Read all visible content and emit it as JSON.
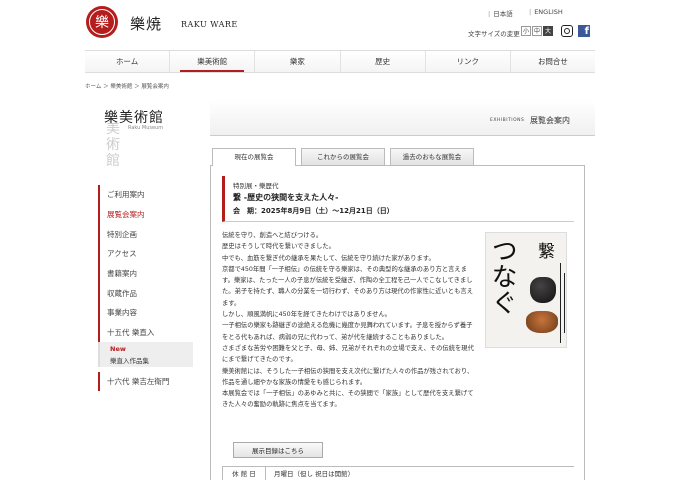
{
  "header": {
    "logo_char": "樂",
    "brand_ja": "樂焼",
    "brand_en": "RAKU WARE",
    "lang_ja": "日本語",
    "lang_en": "ENGLISH",
    "font_size_label": "文字サイズの変更",
    "font_sizes": [
      "小",
      "中",
      "大"
    ],
    "social": [
      "instagram-icon",
      "facebook-icon"
    ]
  },
  "nav": {
    "items": [
      "ホーム",
      "樂美術館",
      "樂家",
      "歴史",
      "リンク",
      "お問合せ"
    ],
    "active_index": 1
  },
  "breadcrumb": "ホーム ＞ 樂美術館 ＞ 展覧会案内",
  "museum": {
    "title": "樂美術館",
    "subtitle": "Raku Museum"
  },
  "banner": {
    "en": "EXHIBITIONS",
    "ja": "展覧会案内"
  },
  "sidebar": {
    "items": [
      "ご利用案内",
      "展覧会案内",
      "特別企画",
      "アクセス",
      "書籍案内",
      "収蔵作品",
      "事業内容",
      "十五代 樂直入"
    ],
    "active_index": 1,
    "sub_new": "New",
    "sub_label": "樂直入作品集",
    "last_item": "十六代 樂吉左衛門"
  },
  "tabs": [
    "現在の展覧会",
    "これからの展覧会",
    "過去のおもな展覧会"
  ],
  "exhibition": {
    "category": "特別展・樂歴代",
    "title": "繋 -歴史の狭間を支えた人々-",
    "period": "会　期：2025年8月9日（土）～12月21日（日）"
  },
  "body_paragraphs": [
    "伝統を守り、創造へと結びつける。",
    "歴史はそうして時代を繋いできました。",
    "中でも、血筋を繋ぎ代の継承を果たして、伝統を守り続けた家があります。",
    "京都で450年間「一子相伝」の伝統を守る樂家は、その典型的な継承のあり方と言えます。樂家は、たった一人の子息が伝統を受継ぎ、作陶の全工程を己一人でこなしてきました。弟子を持たず、職人の分業を一切行わず、そのあり方は現代の作家性に近いとも言えます。",
    "しかし、順風満帆に450年を経てきたわけではありません。",
    "一子相伝の樂家も跡継ぎの途絶える危機に幾度か見舞われています。子息を授からず養子をとる代もあれば、病弱の兄に代わって、弟が代を継続することもありました。",
    "さまざまな苦労や困難を父と子、母、姉、兄弟がそれぞれの立場で支え、その伝統を現代にまで繋げてきたのです。",
    "樂美術館には、そうした一子相伝の狭間を支え次代に繋げた人々の作品が残されており、作品を通し細やかな家族の情愛をも感じられます。",
    "本展覧会では「一子相伝」のあゆみと共に、その狭間で「家族」として歴代を支え繋げてきた人々の奮励の軌跡に焦点を当てます。"
  ],
  "poster": {
    "vertical_text": "つなぐ",
    "kanji": "繋"
  },
  "catalog_button": "展示目録はこちら",
  "info": {
    "key": "休 館 日",
    "value": "月曜日（但し 祝日は開館）"
  },
  "colors": {
    "accent": "#b51d1d",
    "facebook": "#3b5998"
  }
}
